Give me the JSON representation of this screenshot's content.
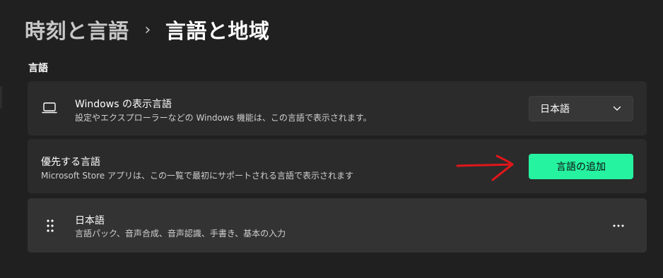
{
  "breadcrumb": {
    "parent": "時刻と言語",
    "separator": "›",
    "current": "言語と地域"
  },
  "section_title": "言語",
  "display_language": {
    "icon": "laptop-icon",
    "title": "Windows の表示言語",
    "description": "設定やエクスプローラーなどの Windows 機能は、この言語で表示されます。",
    "selected": "日本語"
  },
  "preferred_languages": {
    "title": "優先する言語",
    "description": "Microsoft Store アプリは、この一覧で最初にサポートされる言語で表示されます",
    "add_button": "言語の追加"
  },
  "language_item": {
    "icon": "drag-handle-icon",
    "title": "日本語",
    "description": "言語パック、音声合成、音声認識、手書き、基本の入力",
    "more": "…"
  },
  "colors": {
    "background": "#202020",
    "card": "#2b2b2b",
    "accent_button": "#26f3a0",
    "annotation_arrow": "#e0161b"
  }
}
